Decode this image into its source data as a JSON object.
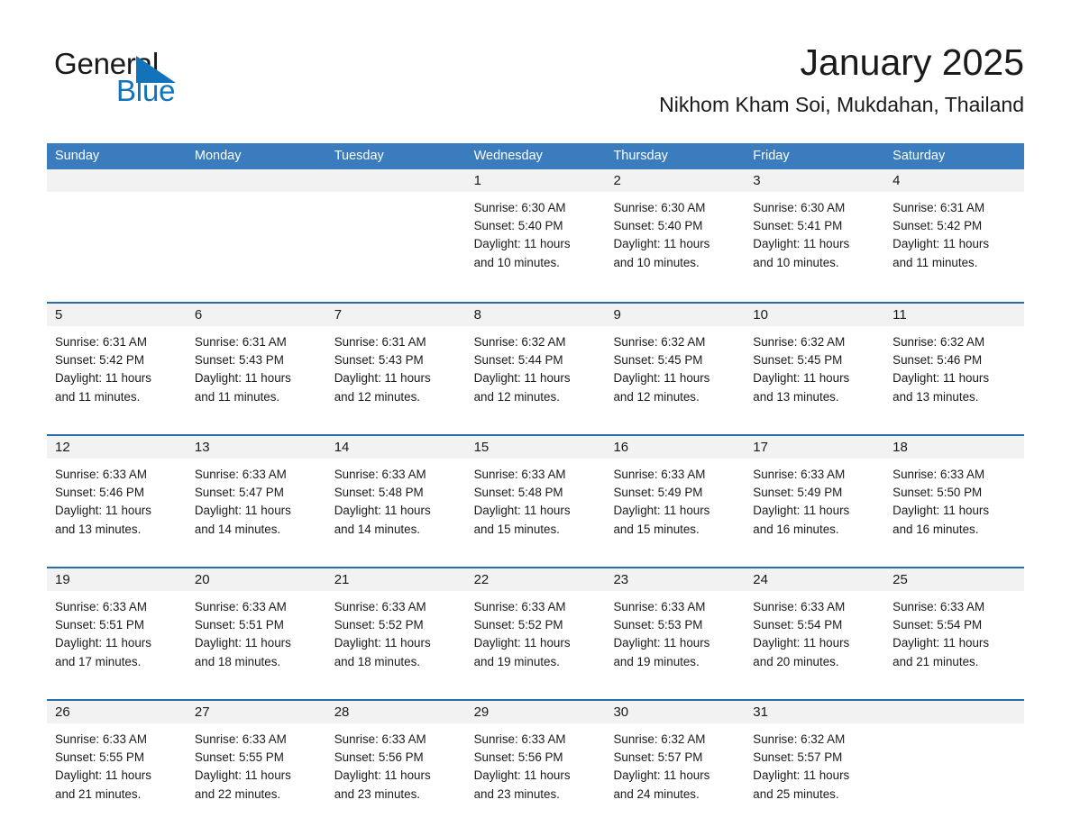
{
  "brand": {
    "name_part1": "General",
    "name_part2": "Blue",
    "triangle_color": "#1273ba",
    "blue_text_color": "#1273ba"
  },
  "header": {
    "title": "January 2025",
    "subtitle": "Nikhom Kham Soi, Mukdahan, Thailand"
  },
  "theme": {
    "header_bg": "#3a7cbe",
    "row_border": "#2b6ba8",
    "day_band_bg": "#f2f2f2",
    "text_color": "#1a1a1a"
  },
  "weekdays": [
    "Sunday",
    "Monday",
    "Tuesday",
    "Wednesday",
    "Thursday",
    "Friday",
    "Saturday"
  ],
  "weeks": [
    [
      {
        "day": "",
        "lines": []
      },
      {
        "day": "",
        "lines": []
      },
      {
        "day": "",
        "lines": []
      },
      {
        "day": "1",
        "lines": [
          "Sunrise: 6:30 AM",
          "Sunset: 5:40 PM",
          "Daylight: 11 hours",
          "and 10 minutes."
        ]
      },
      {
        "day": "2",
        "lines": [
          "Sunrise: 6:30 AM",
          "Sunset: 5:40 PM",
          "Daylight: 11 hours",
          "and 10 minutes."
        ]
      },
      {
        "day": "3",
        "lines": [
          "Sunrise: 6:30 AM",
          "Sunset: 5:41 PM",
          "Daylight: 11 hours",
          "and 10 minutes."
        ]
      },
      {
        "day": "4",
        "lines": [
          "Sunrise: 6:31 AM",
          "Sunset: 5:42 PM",
          "Daylight: 11 hours",
          "and 11 minutes."
        ]
      }
    ],
    [
      {
        "day": "5",
        "lines": [
          "Sunrise: 6:31 AM",
          "Sunset: 5:42 PM",
          "Daylight: 11 hours",
          "and 11 minutes."
        ]
      },
      {
        "day": "6",
        "lines": [
          "Sunrise: 6:31 AM",
          "Sunset: 5:43 PM",
          "Daylight: 11 hours",
          "and 11 minutes."
        ]
      },
      {
        "day": "7",
        "lines": [
          "Sunrise: 6:31 AM",
          "Sunset: 5:43 PM",
          "Daylight: 11 hours",
          "and 12 minutes."
        ]
      },
      {
        "day": "8",
        "lines": [
          "Sunrise: 6:32 AM",
          "Sunset: 5:44 PM",
          "Daylight: 11 hours",
          "and 12 minutes."
        ]
      },
      {
        "day": "9",
        "lines": [
          "Sunrise: 6:32 AM",
          "Sunset: 5:45 PM",
          "Daylight: 11 hours",
          "and 12 minutes."
        ]
      },
      {
        "day": "10",
        "lines": [
          "Sunrise: 6:32 AM",
          "Sunset: 5:45 PM",
          "Daylight: 11 hours",
          "and 13 minutes."
        ]
      },
      {
        "day": "11",
        "lines": [
          "Sunrise: 6:32 AM",
          "Sunset: 5:46 PM",
          "Daylight: 11 hours",
          "and 13 minutes."
        ]
      }
    ],
    [
      {
        "day": "12",
        "lines": [
          "Sunrise: 6:33 AM",
          "Sunset: 5:46 PM",
          "Daylight: 11 hours",
          "and 13 minutes."
        ]
      },
      {
        "day": "13",
        "lines": [
          "Sunrise: 6:33 AM",
          "Sunset: 5:47 PM",
          "Daylight: 11 hours",
          "and 14 minutes."
        ]
      },
      {
        "day": "14",
        "lines": [
          "Sunrise: 6:33 AM",
          "Sunset: 5:48 PM",
          "Daylight: 11 hours",
          "and 14 minutes."
        ]
      },
      {
        "day": "15",
        "lines": [
          "Sunrise: 6:33 AM",
          "Sunset: 5:48 PM",
          "Daylight: 11 hours",
          "and 15 minutes."
        ]
      },
      {
        "day": "16",
        "lines": [
          "Sunrise: 6:33 AM",
          "Sunset: 5:49 PM",
          "Daylight: 11 hours",
          "and 15 minutes."
        ]
      },
      {
        "day": "17",
        "lines": [
          "Sunrise: 6:33 AM",
          "Sunset: 5:49 PM",
          "Daylight: 11 hours",
          "and 16 minutes."
        ]
      },
      {
        "day": "18",
        "lines": [
          "Sunrise: 6:33 AM",
          "Sunset: 5:50 PM",
          "Daylight: 11 hours",
          "and 16 minutes."
        ]
      }
    ],
    [
      {
        "day": "19",
        "lines": [
          "Sunrise: 6:33 AM",
          "Sunset: 5:51 PM",
          "Daylight: 11 hours",
          "and 17 minutes."
        ]
      },
      {
        "day": "20",
        "lines": [
          "Sunrise: 6:33 AM",
          "Sunset: 5:51 PM",
          "Daylight: 11 hours",
          "and 18 minutes."
        ]
      },
      {
        "day": "21",
        "lines": [
          "Sunrise: 6:33 AM",
          "Sunset: 5:52 PM",
          "Daylight: 11 hours",
          "and 18 minutes."
        ]
      },
      {
        "day": "22",
        "lines": [
          "Sunrise: 6:33 AM",
          "Sunset: 5:52 PM",
          "Daylight: 11 hours",
          "and 19 minutes."
        ]
      },
      {
        "day": "23",
        "lines": [
          "Sunrise: 6:33 AM",
          "Sunset: 5:53 PM",
          "Daylight: 11 hours",
          "and 19 minutes."
        ]
      },
      {
        "day": "24",
        "lines": [
          "Sunrise: 6:33 AM",
          "Sunset: 5:54 PM",
          "Daylight: 11 hours",
          "and 20 minutes."
        ]
      },
      {
        "day": "25",
        "lines": [
          "Sunrise: 6:33 AM",
          "Sunset: 5:54 PM",
          "Daylight: 11 hours",
          "and 21 minutes."
        ]
      }
    ],
    [
      {
        "day": "26",
        "lines": [
          "Sunrise: 6:33 AM",
          "Sunset: 5:55 PM",
          "Daylight: 11 hours",
          "and 21 minutes."
        ]
      },
      {
        "day": "27",
        "lines": [
          "Sunrise: 6:33 AM",
          "Sunset: 5:55 PM",
          "Daylight: 11 hours",
          "and 22 minutes."
        ]
      },
      {
        "day": "28",
        "lines": [
          "Sunrise: 6:33 AM",
          "Sunset: 5:56 PM",
          "Daylight: 11 hours",
          "and 23 minutes."
        ]
      },
      {
        "day": "29",
        "lines": [
          "Sunrise: 6:33 AM",
          "Sunset: 5:56 PM",
          "Daylight: 11 hours",
          "and 23 minutes."
        ]
      },
      {
        "day": "30",
        "lines": [
          "Sunrise: 6:32 AM",
          "Sunset: 5:57 PM",
          "Daylight: 11 hours",
          "and 24 minutes."
        ]
      },
      {
        "day": "31",
        "lines": [
          "Sunrise: 6:32 AM",
          "Sunset: 5:57 PM",
          "Daylight: 11 hours",
          "and 25 minutes."
        ]
      },
      {
        "day": "",
        "lines": []
      }
    ]
  ]
}
